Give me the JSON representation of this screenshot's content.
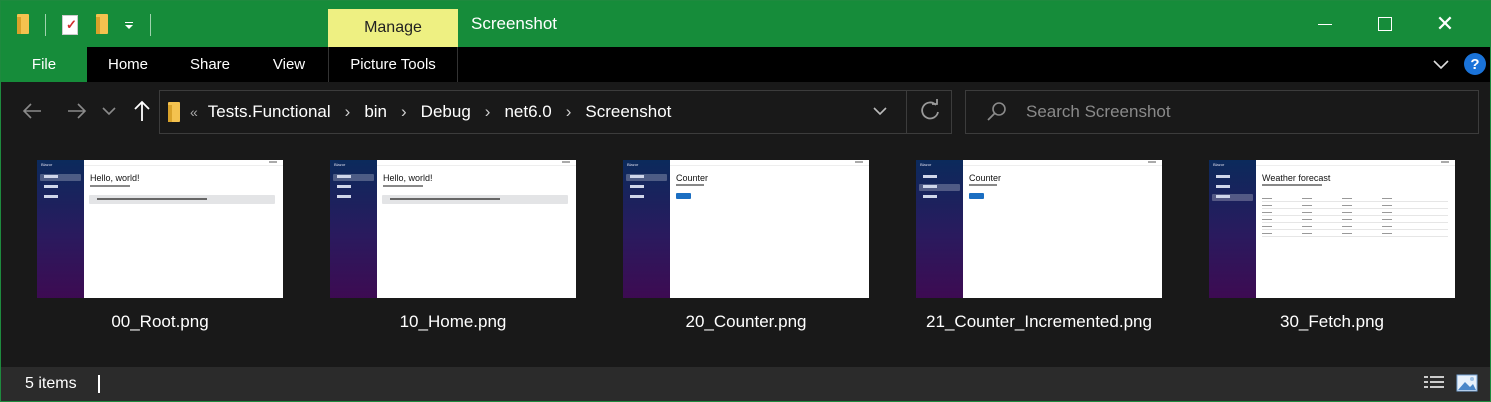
{
  "titlebar": {
    "manage_tab": "Manage",
    "title": "Screenshot",
    "minimize": "minimize",
    "maximize": "maximize",
    "close": "✕"
  },
  "ribbon": {
    "tabs": [
      {
        "label": "File"
      },
      {
        "label": "Home"
      },
      {
        "label": "Share"
      },
      {
        "label": "View"
      },
      {
        "label": "Picture Tools"
      }
    ],
    "help": "?"
  },
  "nav": {
    "overflow": "«",
    "path": [
      "Tests.Functional",
      "bin",
      "Debug",
      "net6.0",
      "Screenshot"
    ],
    "search_placeholder": "Search Screenshot"
  },
  "files": [
    {
      "name": "00_Root.png",
      "thumb_heading": "Hello, world!",
      "kind": "home",
      "active_nav": 0
    },
    {
      "name": "10_Home.png",
      "thumb_heading": "Hello, world!",
      "kind": "home",
      "active_nav": 0
    },
    {
      "name": "20_Counter.png",
      "thumb_heading": "Counter",
      "kind": "counter",
      "active_nav": 0
    },
    {
      "name": "21_Counter_Incremented.png",
      "thumb_heading": "Counter",
      "kind": "counter",
      "active_nav": 1
    },
    {
      "name": "30_Fetch.png",
      "thumb_heading": "Weather forecast",
      "kind": "fetch",
      "active_nav": 2
    }
  ],
  "status": {
    "count": "5 items"
  },
  "colors": {
    "accent": "#168c3a",
    "manage_tab": "#eef082",
    "background": "#191919"
  }
}
